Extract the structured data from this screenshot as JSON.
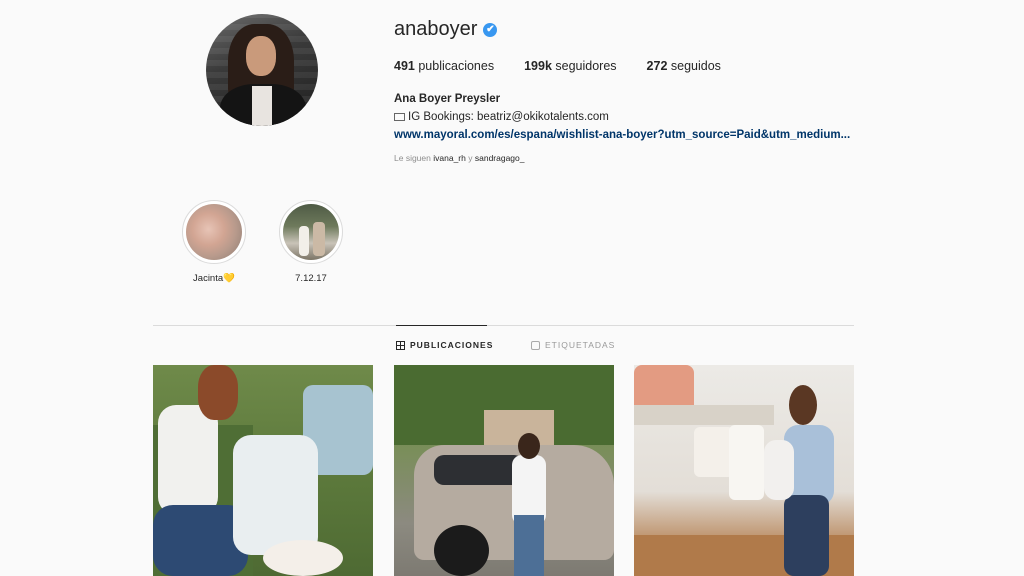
{
  "profile": {
    "username": "anaboyer",
    "verified_badge": "✔",
    "stats": [
      {
        "value": "491",
        "label": "publicaciones"
      },
      {
        "value": "199k",
        "label": "seguidores"
      },
      {
        "value": "272",
        "label": "seguidos"
      }
    ],
    "full_name": "Ana Boyer Preysler",
    "bio_line": "IG Bookings: beatriz@okikotalents.com",
    "link": "www.mayoral.com/es/espana/wishlist-ana-boyer?utm_source=Paid&utm_medium...",
    "followed_by_prefix": "Le siguen",
    "followed_by_1": "ivana_rh",
    "followed_by_sep": "y",
    "followed_by_2": "sandragago_"
  },
  "highlights": [
    {
      "label": "Jacinta💛"
    },
    {
      "label": "7.12.17"
    }
  ],
  "tabs": {
    "posts": "PUBLICACIONES",
    "tagged": "ETIQUETADAS"
  },
  "colors": {
    "accent": "#3897f0",
    "link": "#003569",
    "text": "#262626",
    "muted": "#8e8e8e",
    "divider": "#dbdbdb"
  }
}
